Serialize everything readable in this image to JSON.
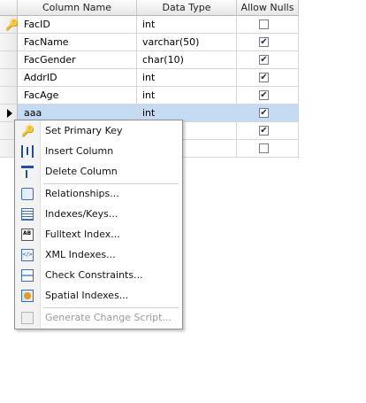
{
  "grid": {
    "headers": {
      "column_name": "Column Name",
      "data_type": "Data Type",
      "allow_nulls": "Allow Nulls"
    },
    "rows": [
      {
        "name": "FacID",
        "type": "int",
        "allow_nulls": false,
        "primary_key": true
      },
      {
        "name": "FacName",
        "type": "varchar(50)",
        "allow_nulls": true
      },
      {
        "name": "FacGender",
        "type": "char(10)",
        "allow_nulls": true
      },
      {
        "name": "AddrID",
        "type": "int",
        "allow_nulls": true
      },
      {
        "name": "FacAge",
        "type": "int",
        "allow_nulls": true
      },
      {
        "name": "aaa",
        "type": "int",
        "allow_nulls": true,
        "selected": true
      },
      {
        "name": "",
        "type": "",
        "allow_nulls": true
      },
      {
        "name": "",
        "type": "",
        "allow_nulls": false
      }
    ]
  },
  "context_menu": {
    "items": [
      {
        "label": "Set Primary Key",
        "icon": "key-icon"
      },
      {
        "label": "Insert Column",
        "icon": "insert-column-icon"
      },
      {
        "label": "Delete Column",
        "icon": "delete-column-icon"
      },
      {
        "label": "Relationships...",
        "icon": "relationships-icon"
      },
      {
        "label": "Indexes/Keys...",
        "icon": "indexes-keys-icon"
      },
      {
        "label": "Fulltext Index...",
        "icon": "fulltext-index-icon"
      },
      {
        "label": "XML Indexes...",
        "icon": "xml-indexes-icon"
      },
      {
        "label": "Check Constraints...",
        "icon": "check-constraints-icon"
      },
      {
        "label": "Spatial Indexes...",
        "icon": "spatial-indexes-icon"
      },
      {
        "label": "Generate Change Script...",
        "icon": "generate-script-icon",
        "disabled": true
      }
    ]
  },
  "colors": {
    "selected_row": "#c5daf3",
    "key_icon": "#c79a00"
  }
}
